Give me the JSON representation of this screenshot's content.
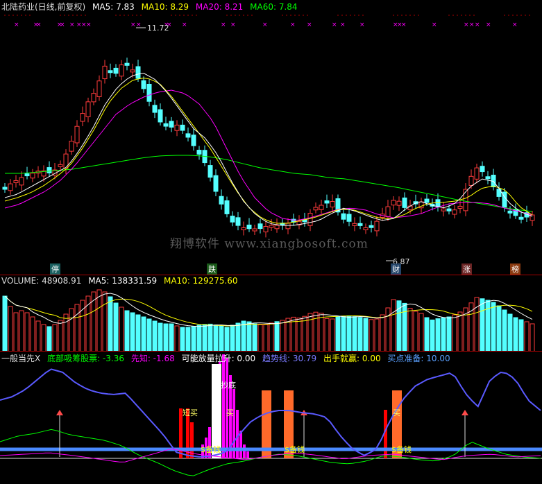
{
  "main": {
    "title": "北陆药业(日线,前复权)",
    "ma5_label": "MA5: 7.83",
    "ma10_label": "MA10: 8.29",
    "ma20_label": "MA20: 8.21",
    "ma60_label": "MA60: 7.84",
    "high_label": "11.72",
    "low_label": "6.87",
    "watermark": "翔博软件 www.xiangbosoft.com",
    "events": [
      "停",
      "跌",
      "财",
      "涨",
      "榜"
    ]
  },
  "volume": {
    "vol_label": "VOLUME: 48908.91",
    "ma5_label": "MA5: 138331.59",
    "ma10_label": "MA10: 129275.60"
  },
  "indicator": {
    "name_label": "一般当先X",
    "bottom_label": "底部吸筹股票: -3.36",
    "foreknow_label": "先知: -1.68",
    "pull_label": "可能放量拉升: 0.00",
    "trend_label": "趋势线: 30.79",
    "shot_label": "出手就赢: 0.00",
    "buy_ready_label": "买点准备: 10.00",
    "bar_text_bottom": "抄底",
    "bar_text_buy1": "短买",
    "bar_text_buy2": "买",
    "bar_text_buy3": "买",
    "money_text_1": "$备钱",
    "money_text_2": "$备钱",
    "money_text_3": "$备钱"
  },
  "colors": {
    "up": "#ff3b3b",
    "down": "#54ffff",
    "ma5": "#ffffff",
    "ma10": "#ffff00",
    "ma20": "#ff00ff",
    "ma60": "#00ff00",
    "trend": "#5a5aff",
    "buy_bar": "#ff6a2a",
    "magenta": "#ff00ff"
  },
  "chart_data": {
    "type": "candlestick",
    "y_high": 11.72,
    "y_low": 6.87,
    "ma_values": {
      "MA5": 7.83,
      "MA10": 8.29,
      "MA20": 8.21,
      "MA60": 7.84
    }
  }
}
